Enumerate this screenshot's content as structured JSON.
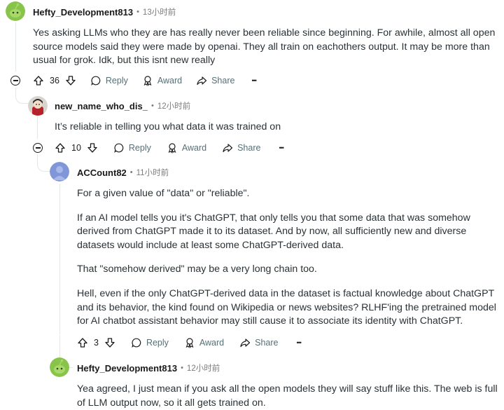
{
  "comments": [
    {
      "username": "Hefty_Development813",
      "separator": "•",
      "time": "13小时前",
      "body": [
        "Yes asking LLMs who they are has really never been reliable since beginning. For awhile, almost all open source models said they were made by openai. They all train on eachothers output. It may be more than usual for grok. Idk, but this isnt new really"
      ],
      "votes": "36",
      "reply_label": "Reply",
      "award_label": "Award",
      "share_label": "Share",
      "more_label": "•••"
    },
    {
      "username": "new_name_who_dis_",
      "separator": "•",
      "time": "12小时前",
      "body": [
        "It’s reliable in telling you what data it was trained on"
      ],
      "votes": "10",
      "reply_label": "Reply",
      "award_label": "Award",
      "share_label": "Share",
      "more_label": "•••"
    },
    {
      "username": "ACCount82",
      "separator": "•",
      "time": "11小时前",
      "body": [
        "For a given value of \"data\" or \"reliable\".",
        "If an AI model tells you it's ChatGPT, that only tells you that some data that was somehow derived from ChatGPT made it to its dataset. And by now, all sufficiently new and diverse datasets would include at least some ChatGPT-derived data.",
        "That \"somehow derived\" may be a very long chain too.",
        "Hell, even if the only ChatGPT-derived data in the dataset is factual knowledge about ChatGPT and its behavior, the kind found on Wikipedia or news websites? RLHF'ing the pretrained model for AI chatbot assistant behavior may still cause it to associate its identity with ChatGPT."
      ],
      "votes": "3",
      "reply_label": "Reply",
      "award_label": "Award",
      "share_label": "Share",
      "more_label": "•••"
    },
    {
      "username": "Hefty_Development813",
      "separator": "•",
      "time": "12小时前",
      "body": [
        "Yea agreed, I just mean if you ask all the open models they will say stuff like this. The web is full of LLM output now, so it all gets trained on."
      ]
    }
  ],
  "colors": {
    "snoo_green": "#88c34a",
    "snoo_blue": "#7f96d9",
    "action_gray": "#576f76",
    "thread_line": "#e2e7e9"
  }
}
